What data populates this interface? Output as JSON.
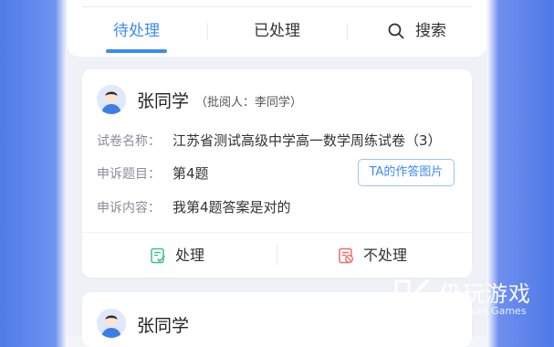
{
  "tabs": [
    {
      "label": "待处理",
      "active": true
    },
    {
      "label": "已处理",
      "active": false
    },
    {
      "label": "搜索",
      "active": false,
      "icon": "search-icon"
    }
  ],
  "cards": [
    {
      "student_name": "张同学",
      "reviewer": "（批阅人：李同学）",
      "rows": [
        {
          "label": "试卷名称：",
          "value": "江苏省测试高级中学高一数学周练试卷（3）"
        },
        {
          "label": "申诉题目：",
          "value": "第4题"
        },
        {
          "label": "申诉内容：",
          "value": "我第4题答案是对的"
        }
      ],
      "photo_button": "TA的作答图片",
      "actions": [
        {
          "label": "处理",
          "icon": "process-check-icon"
        },
        {
          "label": "不处理",
          "icon": "reject-icon"
        }
      ]
    },
    {
      "student_name": "张同学"
    }
  ],
  "watermark": {
    "title": "仍玩游戏",
    "subtitle": "Rengwan Games"
  },
  "colors": {
    "accent": "#3b8bf5",
    "process_icon": "#3fbf8f",
    "reject_icon": "#f06a6a"
  }
}
